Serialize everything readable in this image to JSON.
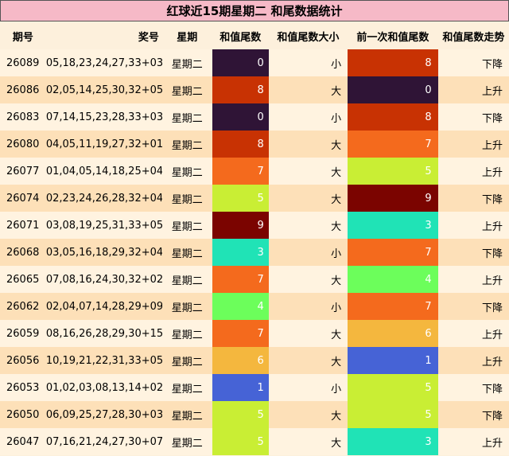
{
  "title": "红球近15期星期二 和尾数据统计",
  "headers": [
    "期号",
    "奖号",
    "星期",
    "和值尾数",
    "和值尾数大小",
    "前一次和值尾数",
    "和值尾数走势"
  ],
  "colors": {
    "0": "#2f1436",
    "1": "#4663d6",
    "2": "#2f1436",
    "3": "#20e3b6",
    "4": "#6cfe5b",
    "5": "#c9ee34",
    "6": "#f4b73e",
    "7": "#f46a1d",
    "8": "#c83203",
    "9": "#7b0400"
  },
  "rows": [
    {
      "period": "26089",
      "numbers": "05,18,23,24,27,33+03",
      "weekday": "星期二",
      "sum_tail": "0",
      "size": "小",
      "prev_tail": "8",
      "trend": "下降"
    },
    {
      "period": "26086",
      "numbers": "02,05,14,25,30,32+05",
      "weekday": "星期二",
      "sum_tail": "8",
      "size": "大",
      "prev_tail": "0",
      "trend": "上升"
    },
    {
      "period": "26083",
      "numbers": "07,14,15,23,28,33+03",
      "weekday": "星期二",
      "sum_tail": "0",
      "size": "小",
      "prev_tail": "8",
      "trend": "下降"
    },
    {
      "period": "26080",
      "numbers": "04,05,11,19,27,32+01",
      "weekday": "星期二",
      "sum_tail": "8",
      "size": "大",
      "prev_tail": "7",
      "trend": "上升"
    },
    {
      "period": "26077",
      "numbers": "01,04,05,14,18,25+04",
      "weekday": "星期二",
      "sum_tail": "7",
      "size": "大",
      "prev_tail": "5",
      "trend": "上升"
    },
    {
      "period": "26074",
      "numbers": "02,23,24,26,28,32+04",
      "weekday": "星期二",
      "sum_tail": "5",
      "size": "大",
      "prev_tail": "9",
      "trend": "下降"
    },
    {
      "period": "26071",
      "numbers": "03,08,19,25,31,33+05",
      "weekday": "星期二",
      "sum_tail": "9",
      "size": "大",
      "prev_tail": "3",
      "trend": "上升"
    },
    {
      "period": "26068",
      "numbers": "03,05,16,18,29,32+04",
      "weekday": "星期二",
      "sum_tail": "3",
      "size": "小",
      "prev_tail": "7",
      "trend": "下降"
    },
    {
      "period": "26065",
      "numbers": "07,08,16,24,30,32+02",
      "weekday": "星期二",
      "sum_tail": "7",
      "size": "大",
      "prev_tail": "4",
      "trend": "上升"
    },
    {
      "period": "26062",
      "numbers": "02,04,07,14,28,29+09",
      "weekday": "星期二",
      "sum_tail": "4",
      "size": "小",
      "prev_tail": "7",
      "trend": "下降"
    },
    {
      "period": "26059",
      "numbers": "08,16,26,28,29,30+15",
      "weekday": "星期二",
      "sum_tail": "7",
      "size": "大",
      "prev_tail": "6",
      "trend": "上升"
    },
    {
      "period": "26056",
      "numbers": "10,19,21,22,31,33+05",
      "weekday": "星期二",
      "sum_tail": "6",
      "size": "大",
      "prev_tail": "1",
      "trend": "上升"
    },
    {
      "period": "26053",
      "numbers": "01,02,03,08,13,14+02",
      "weekday": "星期二",
      "sum_tail": "1",
      "size": "小",
      "prev_tail": "5",
      "trend": "下降"
    },
    {
      "period": "26050",
      "numbers": "06,09,25,27,28,30+03",
      "weekday": "星期二",
      "sum_tail": "5",
      "size": "大",
      "prev_tail": "5",
      "trend": "下降"
    },
    {
      "period": "26047",
      "numbers": "07,16,21,24,27,30+07",
      "weekday": "星期二",
      "sum_tail": "5",
      "size": "大",
      "prev_tail": "3",
      "trend": "上升"
    }
  ]
}
